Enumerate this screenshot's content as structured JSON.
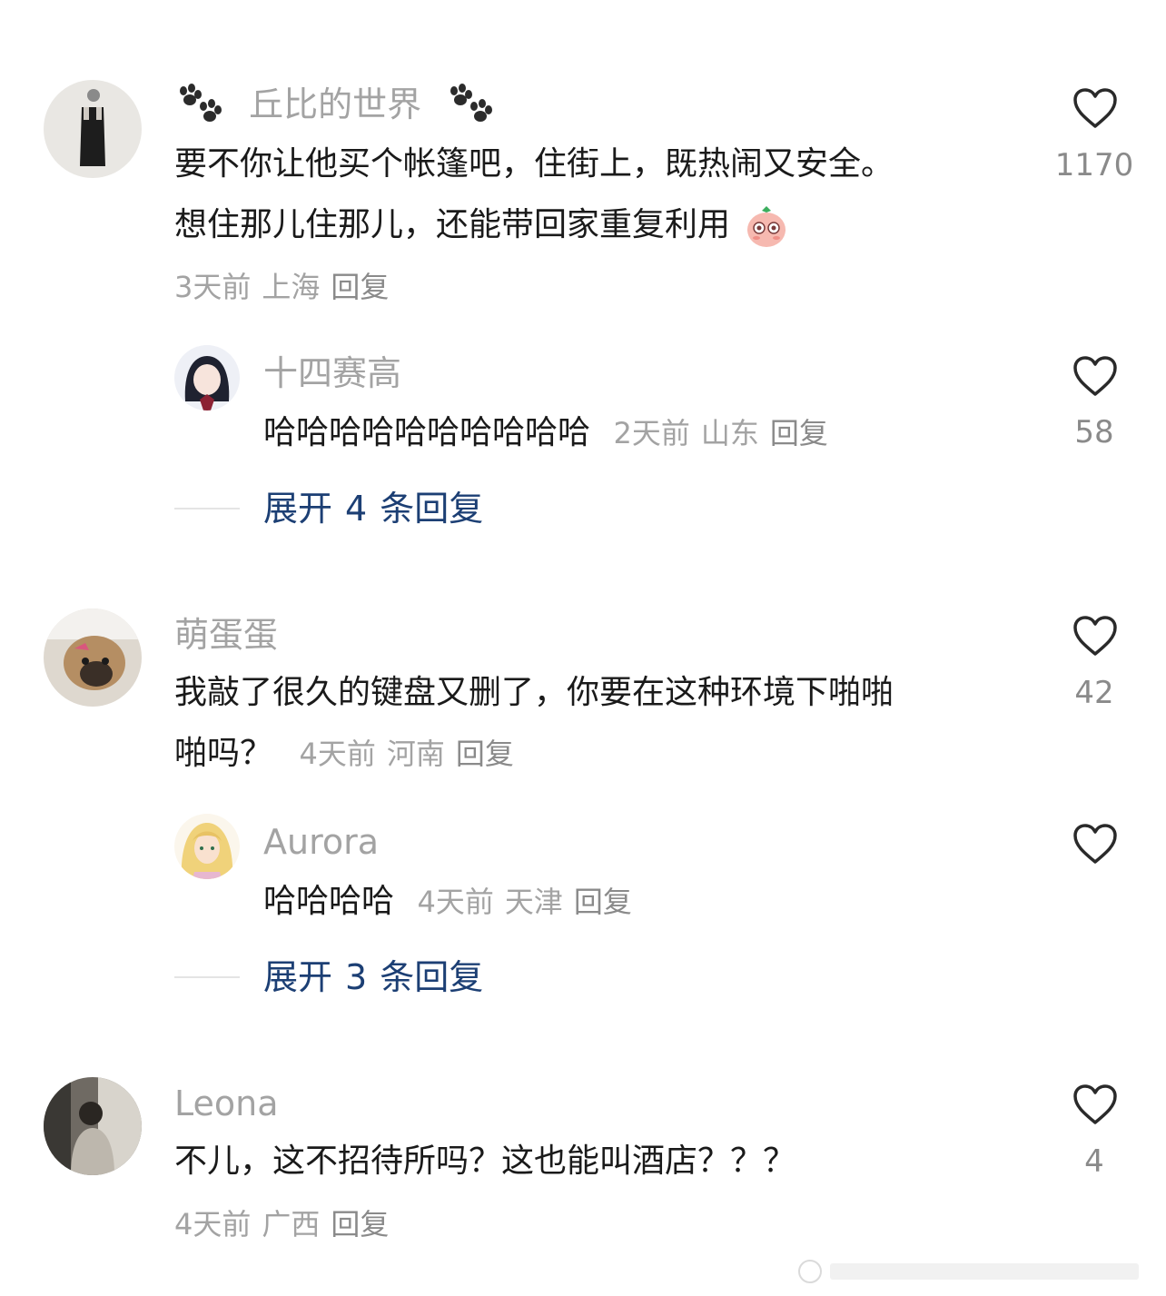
{
  "comments": [
    {
      "username": "丘比的世界",
      "text_line1": "要不你让他买个帐篷吧，住街上，既热闹又安全。",
      "text_line2": "想住那儿住那儿，还能带回家重复利用",
      "emoji_icon": "blushing-peach-emoji",
      "time": "3天前",
      "location": "上海",
      "reply_label": "回复",
      "likes": "1170",
      "sub_reply": {
        "username": "十四赛高",
        "text": "哈哈哈哈哈哈哈哈哈哈",
        "time": "2天前",
        "location": "山东",
        "reply_label": "回复",
        "likes": "58"
      },
      "expand": {
        "prefix": "展开",
        "count": "4",
        "suffix": "条回复"
      }
    },
    {
      "username": "萌蛋蛋",
      "text_line1": "我敲了很久的键盘又删了，你要在这种环境下啪啪",
      "text_line2": "啪吗？",
      "time": "4天前",
      "location": "河南",
      "reply_label": "回复",
      "likes": "42",
      "sub_reply": {
        "username": "Aurora",
        "text": "哈哈哈哈",
        "time": "4天前",
        "location": "天津",
        "reply_label": "回复",
        "likes": ""
      },
      "expand": {
        "prefix": "展开",
        "count": "3",
        "suffix": "条回复"
      }
    },
    {
      "username": "Leona",
      "text_line1": "不儿，这不招待所吗？这也能叫酒店？？？",
      "time": "4天前",
      "location": "广西",
      "reply_label": "回复",
      "likes": "4"
    }
  ],
  "colors": {
    "username": "#a3a3a3",
    "text": "#1a1a1a",
    "meta": "#a3a3a3",
    "expand_link": "#1c3f74",
    "heart_outline": "#2a2a2a"
  }
}
